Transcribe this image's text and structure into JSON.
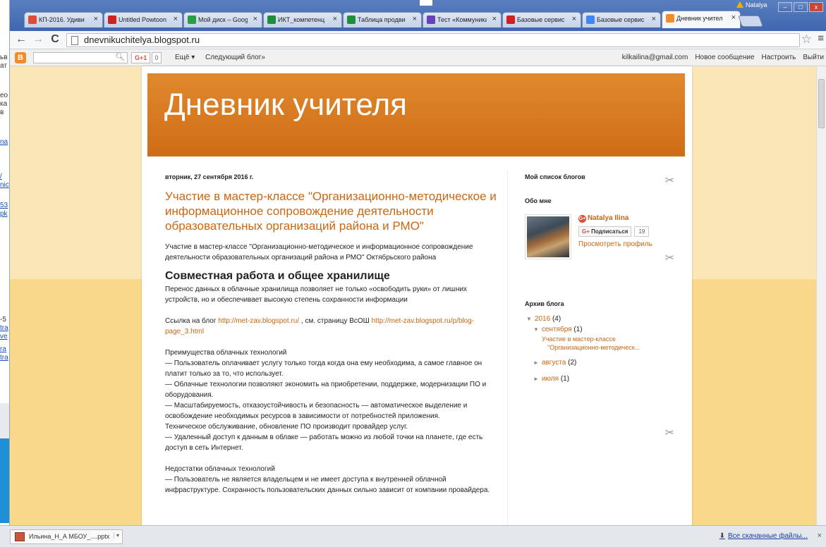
{
  "tabs": [
    {
      "label": "КП-2016. Удиви",
      "icon_color": "#dd4b39",
      "active": false
    },
    {
      "label": "Untitled Powtoon",
      "icon_color": "#cc2222",
      "active": false
    },
    {
      "label": "Мой диск – Goog",
      "icon_color": "#2a9d4a",
      "active": false
    },
    {
      "label": "ИКТ_компетенц",
      "icon_color": "#1e8e3e",
      "active": false
    },
    {
      "label": "Таблица продви",
      "icon_color": "#1e8e3e",
      "active": false
    },
    {
      "label": "Тест «Коммуника",
      "icon_color": "#6741b7",
      "active": false
    },
    {
      "label": "Базовые сервис",
      "icon_color": "#cc2222",
      "active": false
    },
    {
      "label": "Базовые сервис",
      "icon_color": "#4285f4",
      "active": false
    },
    {
      "label": "Дневник учител",
      "icon_color": "#f38b2b",
      "active": true
    }
  ],
  "window": {
    "user": "Natalya"
  },
  "toolbar": {
    "back": "←",
    "forward": "→",
    "reload": "C",
    "url": "dnevnikuchitelya.blogspot.ru",
    "star": "☆",
    "menu": "≡"
  },
  "navbar": {
    "blogger_letter": "B",
    "gplus": "G+1",
    "gplus_count": "0",
    "more": "Ещё ▾",
    "next_blog": "Следующий блог»",
    "email": "kilkailina@gmail.com",
    "new_post": "Новое сообщение",
    "customize": "Настроить",
    "logout": "Выйти"
  },
  "blog": {
    "title": "Дневник учителя",
    "post": {
      "date": "вторник, 27 сентября 2016 г.",
      "title": "Участие в мастер-классе \"Организационно-методическое и информационное сопровождение деятельности образовательных организаций района и РМО\"",
      "intro": "Участие в мастер-классе \"Организационно-методическое и информационное сопровождение деятельности образовательных организаций района и РМО\" Октябрьского района",
      "h2": "Совместная работа и общее хранилище",
      "p1": "Перенос данных в облачные хранилища позволяет не только «освободить руки» от лишних устройств, но и обеспечивает высокую степень сохранности информации",
      "link_prefix": "Ссылка на блог ",
      "link1": "http://met-zav.blogspot.ru/",
      "link_mid": " , см. страницу ВсОШ ",
      "link2": "http://met-zav.blogspot.ru/p/blog-page_3.html",
      "adv_title": "Преимущества облачных технологий",
      "adv1": "— Пользователь оплачивает услугу только тогда когда она ему необходима, а самое главное он платит только за то, что использует.",
      "adv2": "— Облачные технологии позволяют экономить на приобретении, поддержке, модернизации ПО и оборудования.",
      "adv3": "— Масштабируемость, отказоустойчивость и безопасность — автоматическое выделение и освобождение необходимых ресурсов в зависимости от потребностей приложения.",
      "adv4": "Техническое обслуживание, обновление ПО производит провайдер услуг.",
      "adv5": "— Удаленный доступ к данным в облаке — работать можно из любой точки на планете, где есть доступ в сеть Интернет.",
      "dis_title": "Недостатки облачных технологий",
      "dis1": "— Пользователь не является владельцем и не имеет доступа к внутренней облачной инфраструктуре. Сохранность пользовательских данных сильно зависит от компании провайдера."
    },
    "sidebar": {
      "blog_list": "Мой список блогов",
      "about": "Обо мне",
      "profile_name": "Natalya Ilina",
      "follow": "Подписаться",
      "follow_count": "19",
      "view_profile": "Просмотреть профиль",
      "archive_title": "Архив блога",
      "year": "2016",
      "year_count": "(4)",
      "sept": "сентября",
      "sept_count": "(1)",
      "post_link_1": "Участие в мастер-классе",
      "post_link_2": "\"Организационно-методическ...",
      "aug": "августа",
      "aug_count": "(2)",
      "jul": "июля",
      "jul_count": "(1)"
    }
  },
  "downloads": {
    "file": "Ильина_Н_А МБОУ_....pptx",
    "all": "Все скачанные файлы...",
    "close": "×"
  }
}
